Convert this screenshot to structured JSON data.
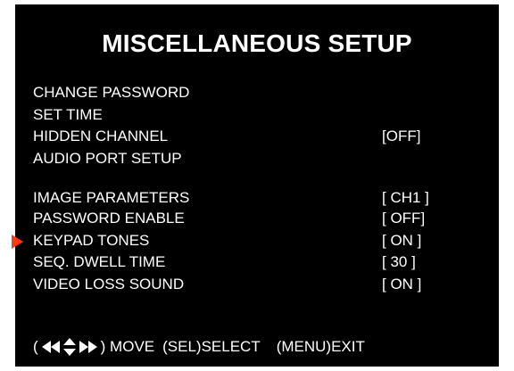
{
  "title": "MISCELLANEOUS SETUP",
  "pointer_color": "#ff3a12",
  "selected_index": 6,
  "menu": [
    {
      "label": "CHANGE PASSWORD",
      "value": ""
    },
    {
      "label": "SET TIME",
      "value": ""
    },
    {
      "label": "HIDDEN CHANNEL",
      "value": "[OFF]"
    },
    {
      "label": "AUDIO PORT SETUP",
      "value": ""
    },
    {
      "label": "IMAGE PARAMETERS",
      "value": "[ CH1 ]"
    },
    {
      "label": "PASSWORD ENABLE",
      "value": "[ OFF]"
    },
    {
      "label": "KEYPAD TONES",
      "value": "[ ON ]"
    },
    {
      "label": "SEQ. DWELL TIME",
      "value": "[ 30 ]"
    },
    {
      "label": "VIDEO LOSS SOUND",
      "value": "[ ON ]"
    }
  ],
  "footer": {
    "open_paren": "(",
    "move": ") MOVE",
    "select": "(SEL)SELECT",
    "exit": "(MENU)EXIT",
    "arrow_icons": "left-right-up-down-arrows-icon"
  }
}
